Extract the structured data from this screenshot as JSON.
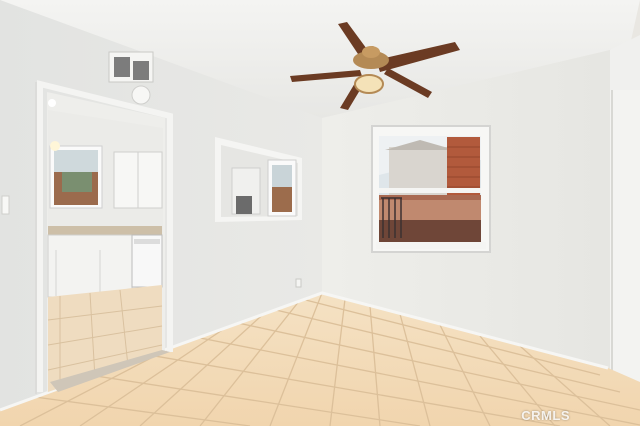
{
  "scene": {
    "description_free": true,
    "colors": {
      "wall_left": "#e3e3df",
      "wall_back": "#ebebe8",
      "ceiling": "#eeeeec",
      "floor_tile": "#f1d9b7",
      "grout": "#d9bd98",
      "fan_blade": "#6b3b23",
      "fan_brass": "#b48a55",
      "brick": "#b25a3c"
    },
    "icons": [
      "ceiling-fan-icon",
      "hvac-vent-icon",
      "smoke-detector-icon"
    ]
  },
  "watermark": {
    "text": "CRMLS"
  }
}
